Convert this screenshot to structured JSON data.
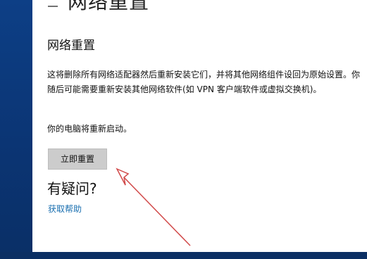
{
  "header": {
    "title": "网络重置"
  },
  "section": {
    "title": "网络重置",
    "description": "这将删除所有网络适配器然后重新安装它们，并将其他网络组件设回为原始设置。你随后可能需要重新安装其他网络软件(如 VPN 客户端软件或虚拟交换机)。",
    "restart_note": "你的电脑将重新启动。",
    "reset_button_label": "立即重置"
  },
  "help": {
    "question": "有疑问?",
    "link_label": "获取帮助"
  },
  "annotation": {
    "arrow_color": "#d14a4a"
  }
}
